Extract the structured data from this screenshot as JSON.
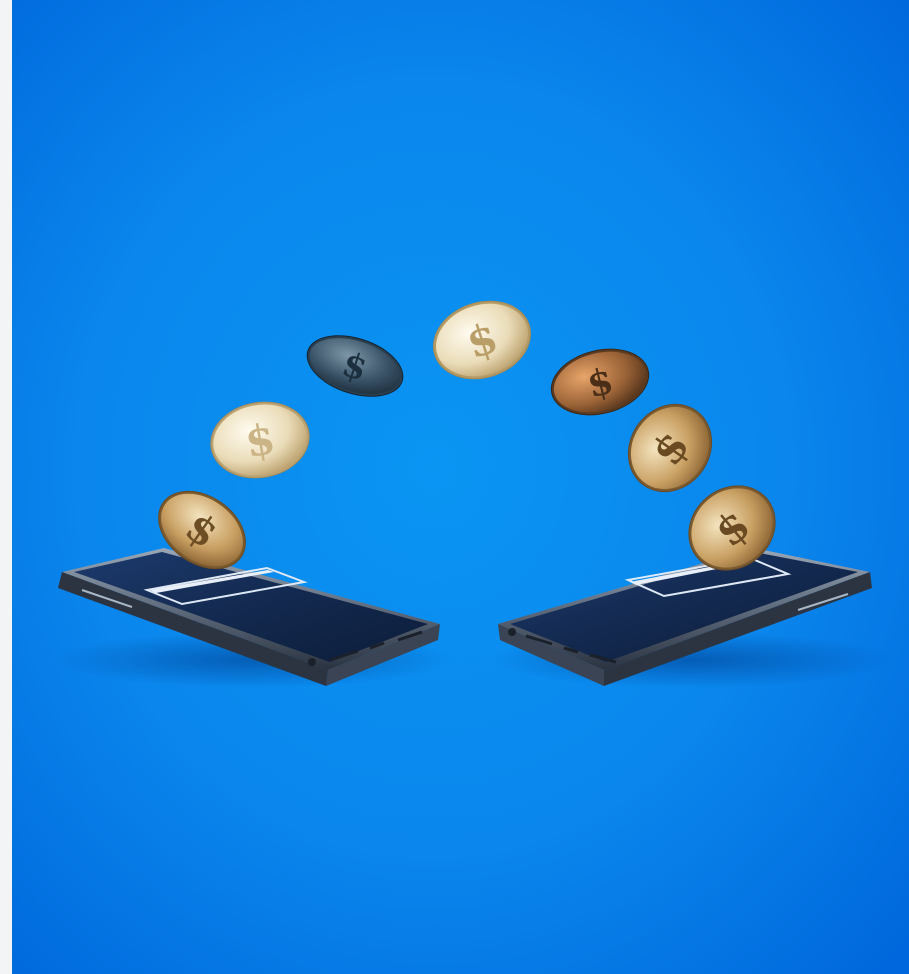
{
  "image": {
    "subject": "two-smartphones-coin-transfer",
    "background_color": "#0a8ef0",
    "background_edge_color": "#0064d8",
    "coin_symbol": "$",
    "coin_count": 7,
    "coin_tones": [
      "#c49a55",
      "#efe3c4",
      "#3d566a",
      "#e6d09a",
      "#9a6a3a",
      "#c8955a",
      "#c2915c"
    ],
    "phone_count": 2
  }
}
